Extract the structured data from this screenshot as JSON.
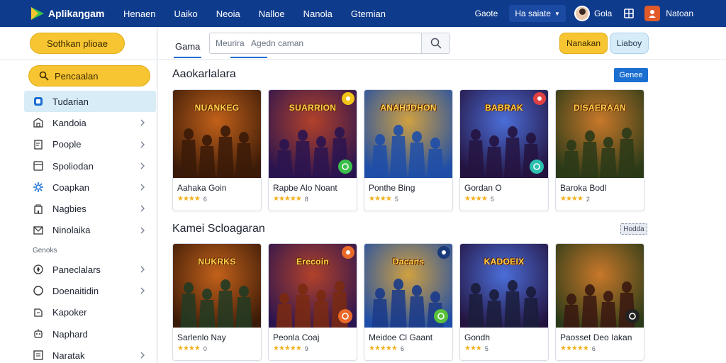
{
  "topbar": {
    "app_title": "Aplikaŋgam",
    "nav": [
      "Henaen",
      "Uaiko",
      "Neoia",
      "Nalloe",
      "Nanola",
      "Gtemian"
    ],
    "right": {
      "link": "Gaote",
      "select_label": "Ha saiate",
      "user_name": "Gola",
      "user2_name": "Natoan"
    },
    "colors": {
      "bar": "#0f3b8c",
      "accent_yellow": "#f7c531",
      "accent_blue": "#1b6fd1"
    }
  },
  "sidebar": {
    "top_button": "Sothkan plioae",
    "search_pill": "Pencaalan",
    "items": [
      {
        "label": "Tudarian",
        "icon": "tag-icon",
        "active": true,
        "chevron": false
      },
      {
        "label": "Kandoia",
        "icon": "store-icon",
        "active": false,
        "chevron": true
      },
      {
        "label": "Poople",
        "icon": "document-icon",
        "active": false,
        "chevron": true
      },
      {
        "label": "Spoliodan",
        "icon": "window-icon",
        "active": false,
        "chevron": true
      },
      {
        "label": "Coapkan",
        "icon": "gear-icon",
        "active": false,
        "chevron": true
      },
      {
        "label": "Nagbies",
        "icon": "building-icon",
        "active": false,
        "chevron": true
      },
      {
        "label": "Ninolaika",
        "icon": "mail-icon",
        "active": false,
        "chevron": true
      }
    ],
    "section_label": "Genoks",
    "items2": [
      {
        "label": "Paneclalars",
        "icon": "compass-icon",
        "chevron": true
      },
      {
        "label": "Doenaitidin",
        "icon": "circle-icon",
        "chevron": true
      },
      {
        "label": "Kapoker",
        "icon": "gamepad-icon",
        "chevron": false
      },
      {
        "label": "Naphard",
        "icon": "bot-icon",
        "chevron": false
      },
      {
        "label": "Naratak",
        "icon": "list-icon",
        "chevron": true
      }
    ]
  },
  "main": {
    "tab": "Gama",
    "search": {
      "placeholder": "Meurira   Agedn caman"
    },
    "buttons": {
      "yellow": "Nanakan",
      "blue": "Liaboy"
    },
    "section1": {
      "title": "Aaokarlalara",
      "button": "Genee",
      "cards": [
        {
          "name": "Aahaka Goin",
          "rating": "6",
          "banner": "NUANKEG",
          "stars": 4,
          "theme": [
            "#3a1a08",
            "#c2611a"
          ],
          "badge": null,
          "overlay": null
        },
        {
          "name": "Rapbe Alo Noant",
          "rating": "8",
          "banner": "SUARRION",
          "stars": 5,
          "theme": [
            "#2a1450",
            "#b2422a"
          ],
          "badge": "#f2c418",
          "overlay": "#3bbf4a"
        },
        {
          "name": "Ponthe Bing",
          "rating": "5",
          "banner": "ANAHJDHON",
          "stars": 4,
          "theme": [
            "#1e4ea8",
            "#d0a040"
          ],
          "badge": null,
          "overlay": null
        },
        {
          "name": "Gordan O",
          "rating": "5",
          "banner": "BABRAK",
          "stars": 4,
          "theme": [
            "#24133f",
            "#4b6ed8"
          ],
          "badge": "#e04040",
          "overlay": "#2abfaf"
        },
        {
          "name": "Baroka Bodl",
          "rating": "2",
          "banner": "DISAERAAN",
          "stars": 4,
          "theme": [
            "#2a3a18",
            "#c8782a"
          ],
          "badge": null,
          "overlay": null
        }
      ]
    },
    "section2": {
      "title": "Kamei Scloagaran",
      "button": "Hodda",
      "cards": [
        {
          "name": "Sarlenlo Nay",
          "rating": "0",
          "banner": "NUKRKS",
          "stars": 4,
          "theme": [
            "#213b23",
            "#c08a3a"
          ],
          "badge": null,
          "overlay": null
        },
        {
          "name": "Peonla Coaj",
          "rating": "9",
          "banner": "Erecoin",
          "stars": 5,
          "theme": [
            "#7a2a10",
            "#f0a030"
          ],
          "badge": "#e86a2a",
          "overlay": "#e86a2a"
        },
        {
          "name": "Meidoe Cl Gaant",
          "rating": "6",
          "banner": "Dacans",
          "stars": 5,
          "theme": [
            "#1a3a8a",
            "#e8b030"
          ],
          "badge": "#1b3a7a",
          "overlay": "#59c03a"
        },
        {
          "name": "Gondh",
          "rating": "5",
          "banner": "KADOEIX",
          "stars": 3,
          "theme": [
            "#1a1c3a",
            "#d88a2a"
          ],
          "badge": null,
          "overlay": null
        },
        {
          "name": "Paosset Deo Iakan",
          "rating": "6",
          "banner": "",
          "stars": 5,
          "theme": [
            "#3a1810",
            "#e0622a"
          ],
          "badge": null,
          "overlay": "#222222"
        }
      ]
    }
  }
}
